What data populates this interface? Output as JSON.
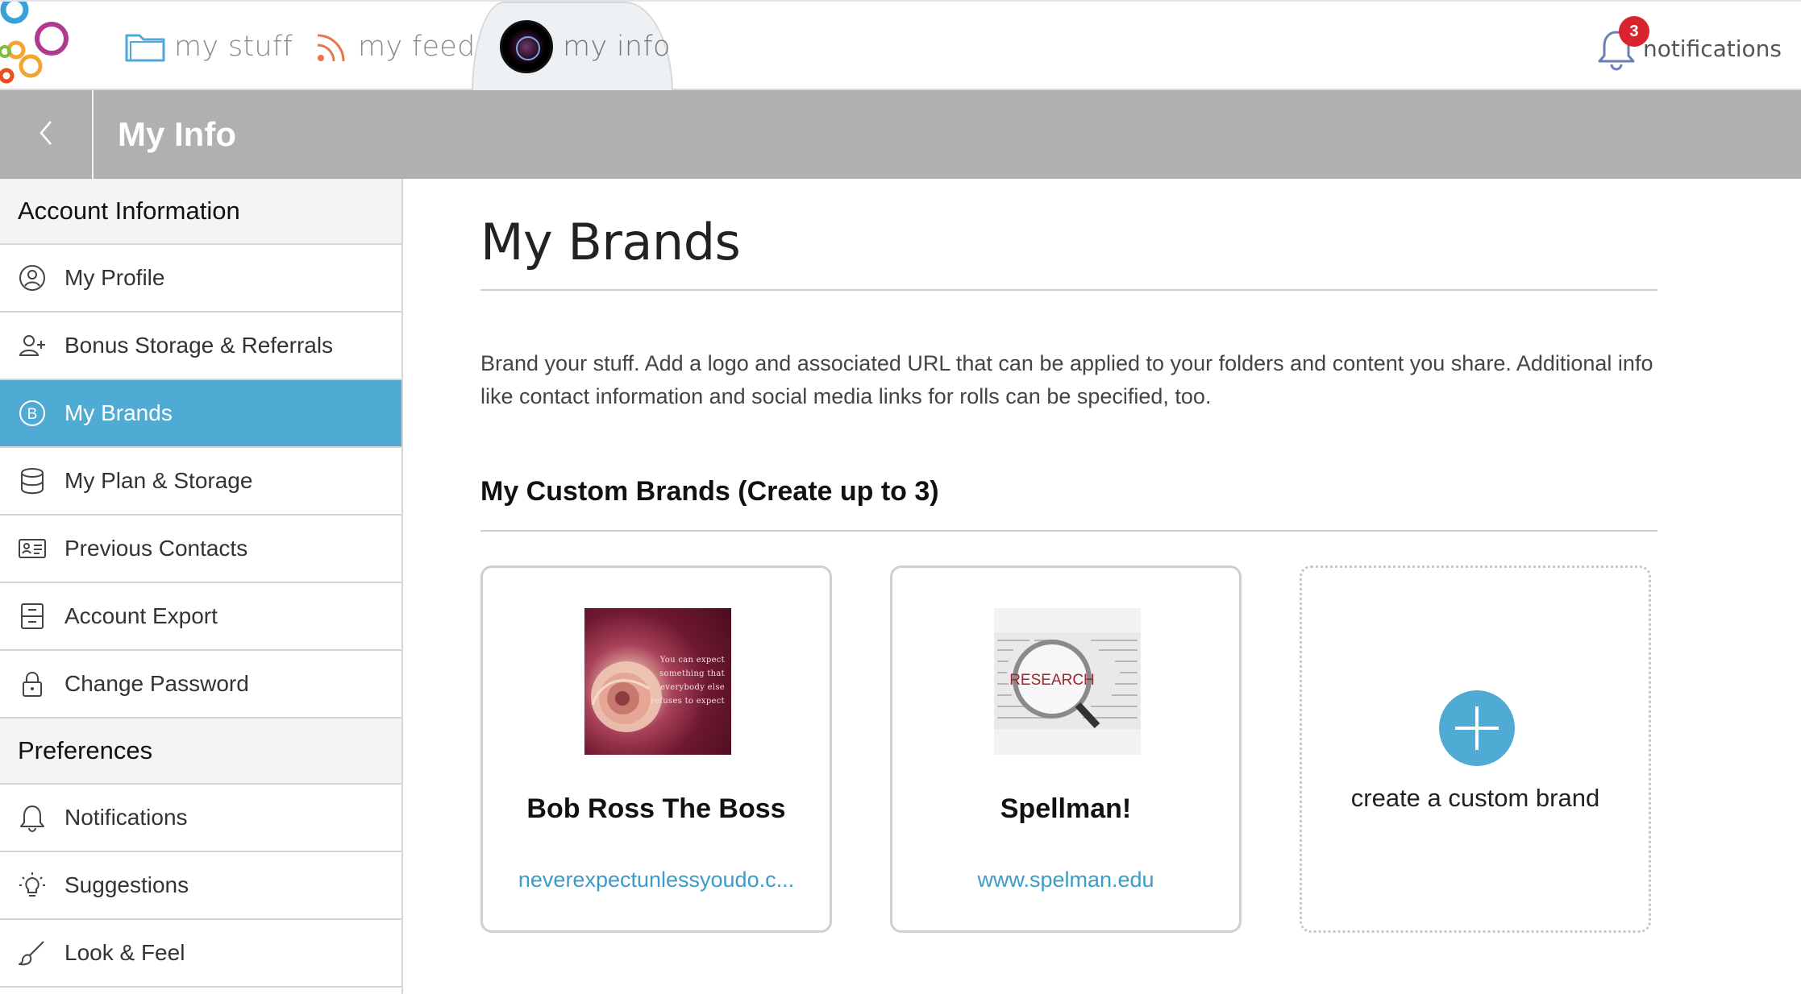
{
  "topbar": {
    "tabs": [
      {
        "label": "my stuff",
        "icon": "folder-icon"
      },
      {
        "label": "my feed",
        "icon": "rss-icon"
      },
      {
        "label": "my info",
        "icon": "avatar"
      }
    ],
    "notifications": {
      "label": "notifications",
      "count": "3"
    }
  },
  "header": {
    "title": "My Info"
  },
  "sidebar": {
    "sections": [
      {
        "title": "Account Information",
        "items": [
          {
            "label": "My Profile",
            "icon": "user-circle-icon"
          },
          {
            "label": "Bonus Storage & Referrals",
            "icon": "user-plus-icon"
          },
          {
            "label": "My Brands",
            "icon": "brand-b-icon",
            "active": true
          },
          {
            "label": "My Plan & Storage",
            "icon": "database-icon"
          },
          {
            "label": "Previous Contacts",
            "icon": "contact-card-icon"
          },
          {
            "label": "Account Export",
            "icon": "archive-icon"
          },
          {
            "label": "Change Password",
            "icon": "lock-icon"
          }
        ]
      },
      {
        "title": "Preferences",
        "items": [
          {
            "label": "Notifications",
            "icon": "bell-icon"
          },
          {
            "label": "Suggestions",
            "icon": "lightbulb-icon"
          },
          {
            "label": "Look & Feel",
            "icon": "brush-icon"
          }
        ]
      }
    ]
  },
  "main": {
    "title": "My Brands",
    "description": "Brand your stuff. Add a logo and associated URL that can be applied to your folders and content you share. Additional info like contact information and social media links for rolls can be specified, too.",
    "custom_heading": "My Custom Brands (Create up to 3)",
    "brands": [
      {
        "name": "Bob Ross The Boss",
        "url": "neverexpectunlessyoudo.c...",
        "thumb_quote": "You can expect something that everybody else refuses to expect"
      },
      {
        "name": "Spellman!",
        "url": "www.spelman.edu",
        "thumb_word": "RESEARCH"
      }
    ],
    "add_label": "create a custom brand"
  },
  "colors": {
    "accent": "#4fabd3",
    "header_band": "#b0b0b0",
    "badge": "#d9232e",
    "link": "#3c9bc7"
  }
}
